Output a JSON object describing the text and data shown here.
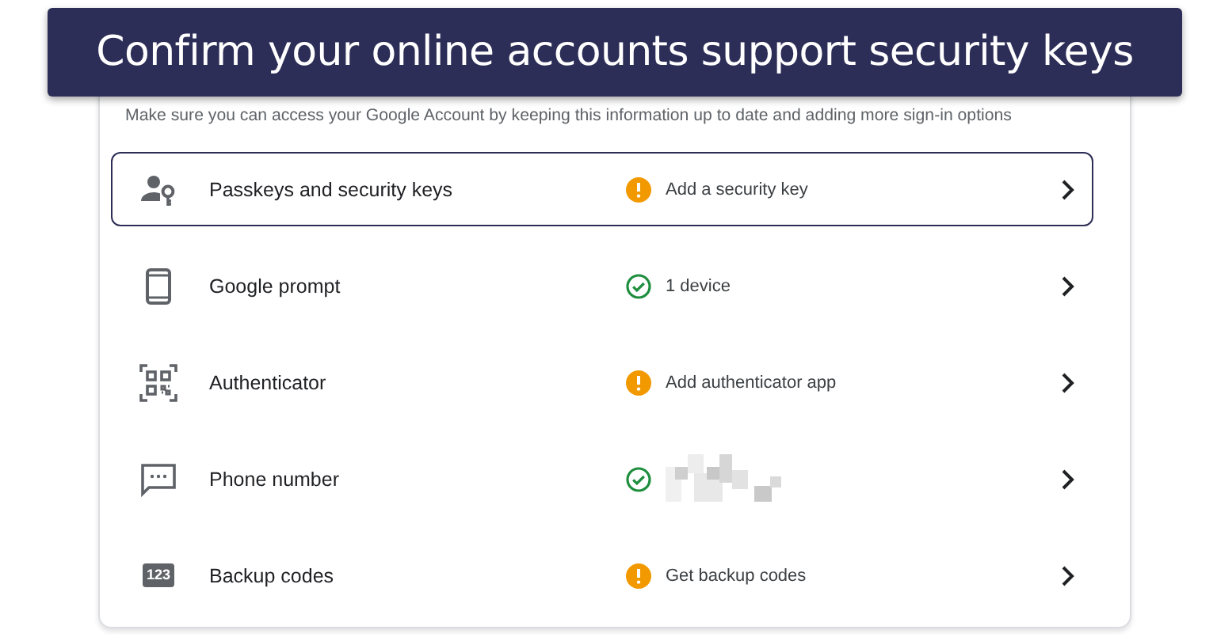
{
  "banner": {
    "title": "Confirm your online accounts support security keys"
  },
  "intro": "Make sure you can access your Google Account by keeping this information up to date and adding more sign-in options",
  "rows": [
    {
      "kind": "passkey",
      "label": "Passkeys and security keys",
      "done": false,
      "value": "Add a security key",
      "selected": true
    },
    {
      "kind": "prompt",
      "label": "Google prompt",
      "done": true,
      "value": "1 device",
      "selected": false
    },
    {
      "kind": "authenticator",
      "label": "Authenticator",
      "done": false,
      "value": "Add authenticator app",
      "selected": false
    },
    {
      "kind": "phone",
      "label": "Phone number",
      "done": true,
      "value_hidden": true,
      "selected": false
    },
    {
      "kind": "codes",
      "icon_text": "123",
      "label": "Backup codes",
      "done": false,
      "value": "Get backup codes",
      "selected": false
    }
  ]
}
